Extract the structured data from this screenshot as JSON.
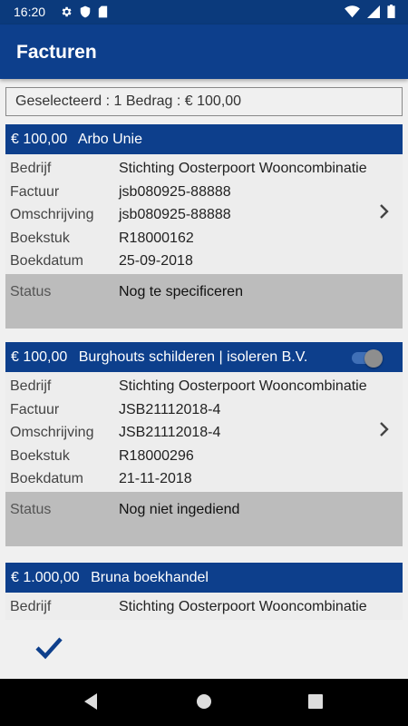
{
  "status_bar": {
    "time": "16:20"
  },
  "app_bar": {
    "title": "Facturen"
  },
  "summary": {
    "text": "Geselecteerd : 1 Bedrag : € 100,00"
  },
  "labels": {
    "bedrijf": "Bedrijf",
    "factuur": "Factuur",
    "omschrijving": "Omschrijving",
    "boekstuk": "Boekstuk",
    "boekdatum": "Boekdatum",
    "status": "Status"
  },
  "invoices": [
    {
      "amount": "€ 100,00",
      "supplier": "Arbo Unie",
      "bedrijf": "Stichting Oosterpoort Wooncombinatie",
      "factuur": "jsb080925-88888",
      "omschrijving": "jsb080925-88888",
      "boekstuk": "R18000162",
      "boekdatum": "25-09-2018",
      "status": "Nog te specificeren",
      "selected": false
    },
    {
      "amount": "€ 100,00",
      "supplier": "Burghouts schilderen | isoleren B.V.",
      "bedrijf": "Stichting Oosterpoort Wooncombinatie",
      "factuur": "JSB21112018-4",
      "omschrijving": "JSB21112018-4",
      "boekstuk": "R18000296",
      "boekdatum": "21-11-2018",
      "status": "Nog niet ingediend",
      "selected": true
    },
    {
      "amount": "€ 1.000,00",
      "supplier": "Bruna boekhandel",
      "bedrijf": "Stichting Oosterpoort Wooncombinatie"
    }
  ],
  "icons": {
    "settings": "gear-icon",
    "shield": "shield-icon",
    "sd_card": "sd-card-icon",
    "wifi": "wifi-icon",
    "signal": "signal-icon",
    "battery": "battery-icon",
    "chevron": "chevron-right-icon",
    "confirm": "checkmark-icon",
    "back": "back-icon",
    "home": "home-icon",
    "recents": "recents-icon"
  },
  "colors": {
    "primary": "#0d3f8c",
    "status_bar": "#0b3a7c",
    "status_row": "#bcbcbc",
    "toggle_track": "#3f6fb6"
  }
}
